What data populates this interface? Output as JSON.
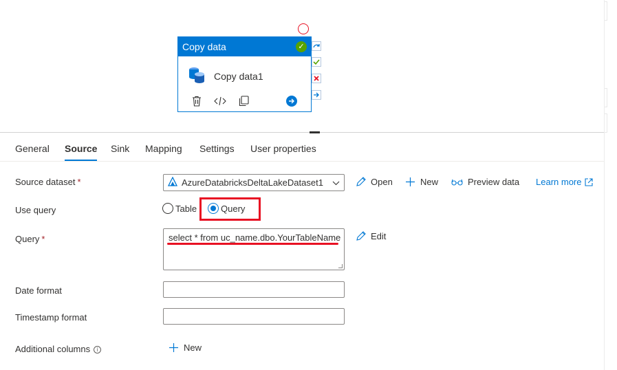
{
  "pipeline": {
    "activity": {
      "header": "Copy data",
      "name": "Copy data1"
    }
  },
  "tabs": [
    {
      "label": "General",
      "active": false
    },
    {
      "label": "Source",
      "active": true
    },
    {
      "label": "Sink",
      "active": false
    },
    {
      "label": "Mapping",
      "active": false
    },
    {
      "label": "Settings",
      "active": false
    },
    {
      "label": "User properties",
      "active": false
    }
  ],
  "source": {
    "dataset_label": "Source dataset",
    "dataset_value": "AzureDatabricksDeltaLakeDataset1",
    "open_label": "Open",
    "new_label": "New",
    "preview_label": "Preview data",
    "learn_more_label": "Learn more",
    "use_query_label": "Use query",
    "use_query_options": [
      "Table",
      "Query"
    ],
    "use_query_selected": "Query",
    "query_label": "Query",
    "query_value": "select * from uc_name.dbo.YourTableName",
    "edit_label": "Edit",
    "date_format_label": "Date format",
    "date_format_value": "",
    "timestamp_format_label": "Timestamp format",
    "timestamp_format_value": "",
    "additional_columns_label": "Additional columns",
    "additional_new_label": "New",
    "required_mark": "*"
  },
  "colors": {
    "accent": "#0078d4",
    "highlight": "#e81123",
    "success": "#57a300"
  }
}
